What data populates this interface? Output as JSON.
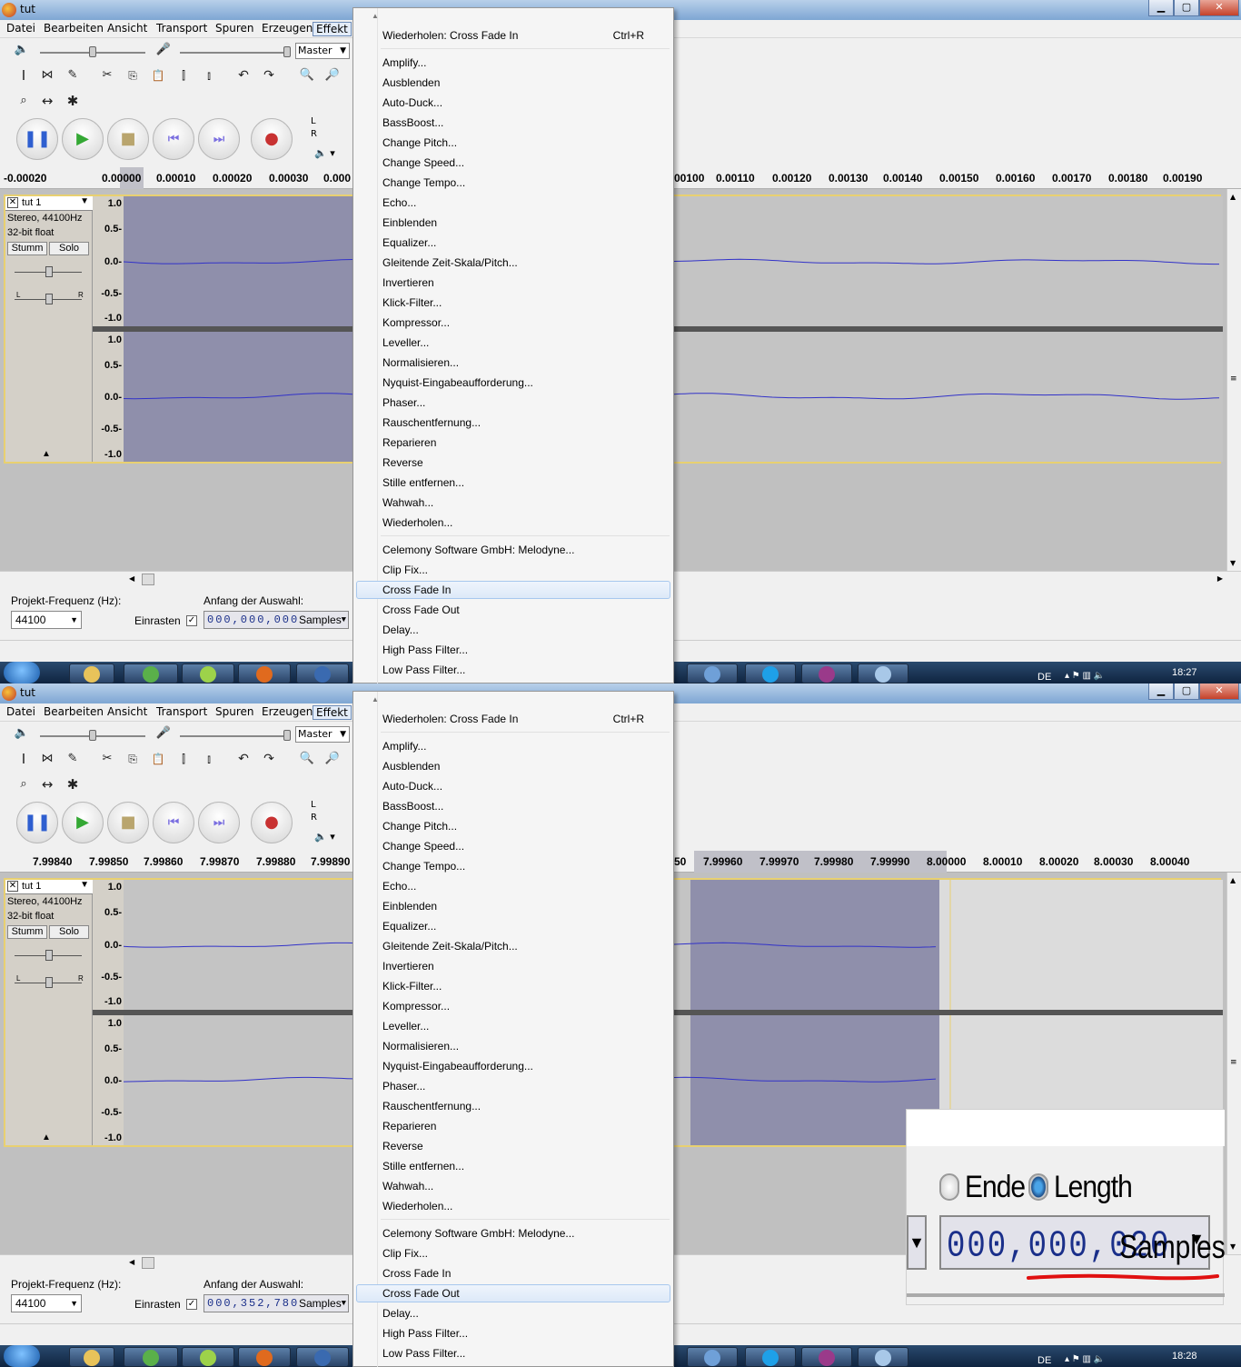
{
  "app": {
    "window_title": "tut",
    "menus": [
      "Datei",
      "Bearbeiten",
      "Ansicht",
      "Transport",
      "Spuren",
      "Erzeugen",
      "Effekt"
    ],
    "active_menu": "Effekt",
    "master_label": "Master",
    "meter_labels": [
      "L",
      "R"
    ]
  },
  "track": {
    "name": "tut 1",
    "format_line1": "Stereo, 44100Hz",
    "format_line2": "32-bit float",
    "mute_label": "Stumm",
    "solo_label": "Solo",
    "pan_left": "L",
    "pan_right": "R",
    "scale": [
      "1.0",
      "0.5-",
      "0.0-",
      "-0.5-",
      "-1.0"
    ]
  },
  "selection_bar": {
    "rate_label": "Projekt-Frequenz (Hz):",
    "rate_value": "44100",
    "snap_label": "Einrasten",
    "start_label": "Anfang der Auswahl:",
    "unit": "Samples"
  },
  "effect_menu": {
    "repeat_label": "Wiederholen: Cross Fade In",
    "repeat_shortcut": "Ctrl+R",
    "builtin": [
      "Amplify...",
      "Ausblenden",
      "Auto-Duck...",
      "BassBoost...",
      "Change Pitch...",
      "Change Speed...",
      "Change Tempo...",
      "Echo...",
      "Einblenden",
      "Equalizer...",
      "Gleitende Zeit-Skala/Pitch...",
      "Invertieren",
      "Klick-Filter...",
      "Kompressor...",
      "Leveller...",
      "Normalisieren...",
      "Nyquist-Eingabeaufforderung...",
      "Phaser...",
      "Rauschentfernung...",
      "Reparieren",
      "Reverse",
      "Stille entfernen...",
      "Wahwah...",
      "Wiederholen..."
    ],
    "plugins": [
      "Celemony Software GmbH: Melodyne...",
      "Clip Fix...",
      "Cross Fade In",
      "Cross Fade Out",
      "Delay...",
      "High Pass Filter...",
      "Low Pass Filter..."
    ]
  },
  "shots": [
    {
      "ruler": [
        "-0.00020",
        "0.00000",
        "0.00010",
        "0.00020",
        "0.00030",
        "0.000",
        "00100",
        "0.00110",
        "0.00120",
        "0.00130",
        "0.00140",
        "0.00150",
        "0.00160",
        "0.00170",
        "0.00180",
        "0.00190"
      ],
      "selection_start": "000,000,000",
      "highlighted_plugin": 2,
      "clock": "18:27",
      "language": "DE"
    },
    {
      "ruler": [
        "7.99840",
        "7.99850",
        "7.99860",
        "7.99870",
        "7.99880",
        "7.99890",
        "50",
        "7.99960",
        "7.99970",
        "7.99980",
        "7.99990",
        "8.00000",
        "8.00010",
        "8.00020",
        "8.00030",
        "8.00040"
      ],
      "selection_start": "000,352,780",
      "highlighted_plugin": 3,
      "clock": "18:28",
      "language": "DE"
    }
  ],
  "zoom_inset": {
    "radio_end": "Ende",
    "radio_length": "Length",
    "length_value": "000,000,020",
    "unit": "Samples"
  },
  "colors": {
    "selection": "#8f8fab",
    "waveform": "#3232c8",
    "track_border": "#e8d070",
    "menu_highlight": "#dde9f8",
    "annotation_red": "#e01010"
  }
}
